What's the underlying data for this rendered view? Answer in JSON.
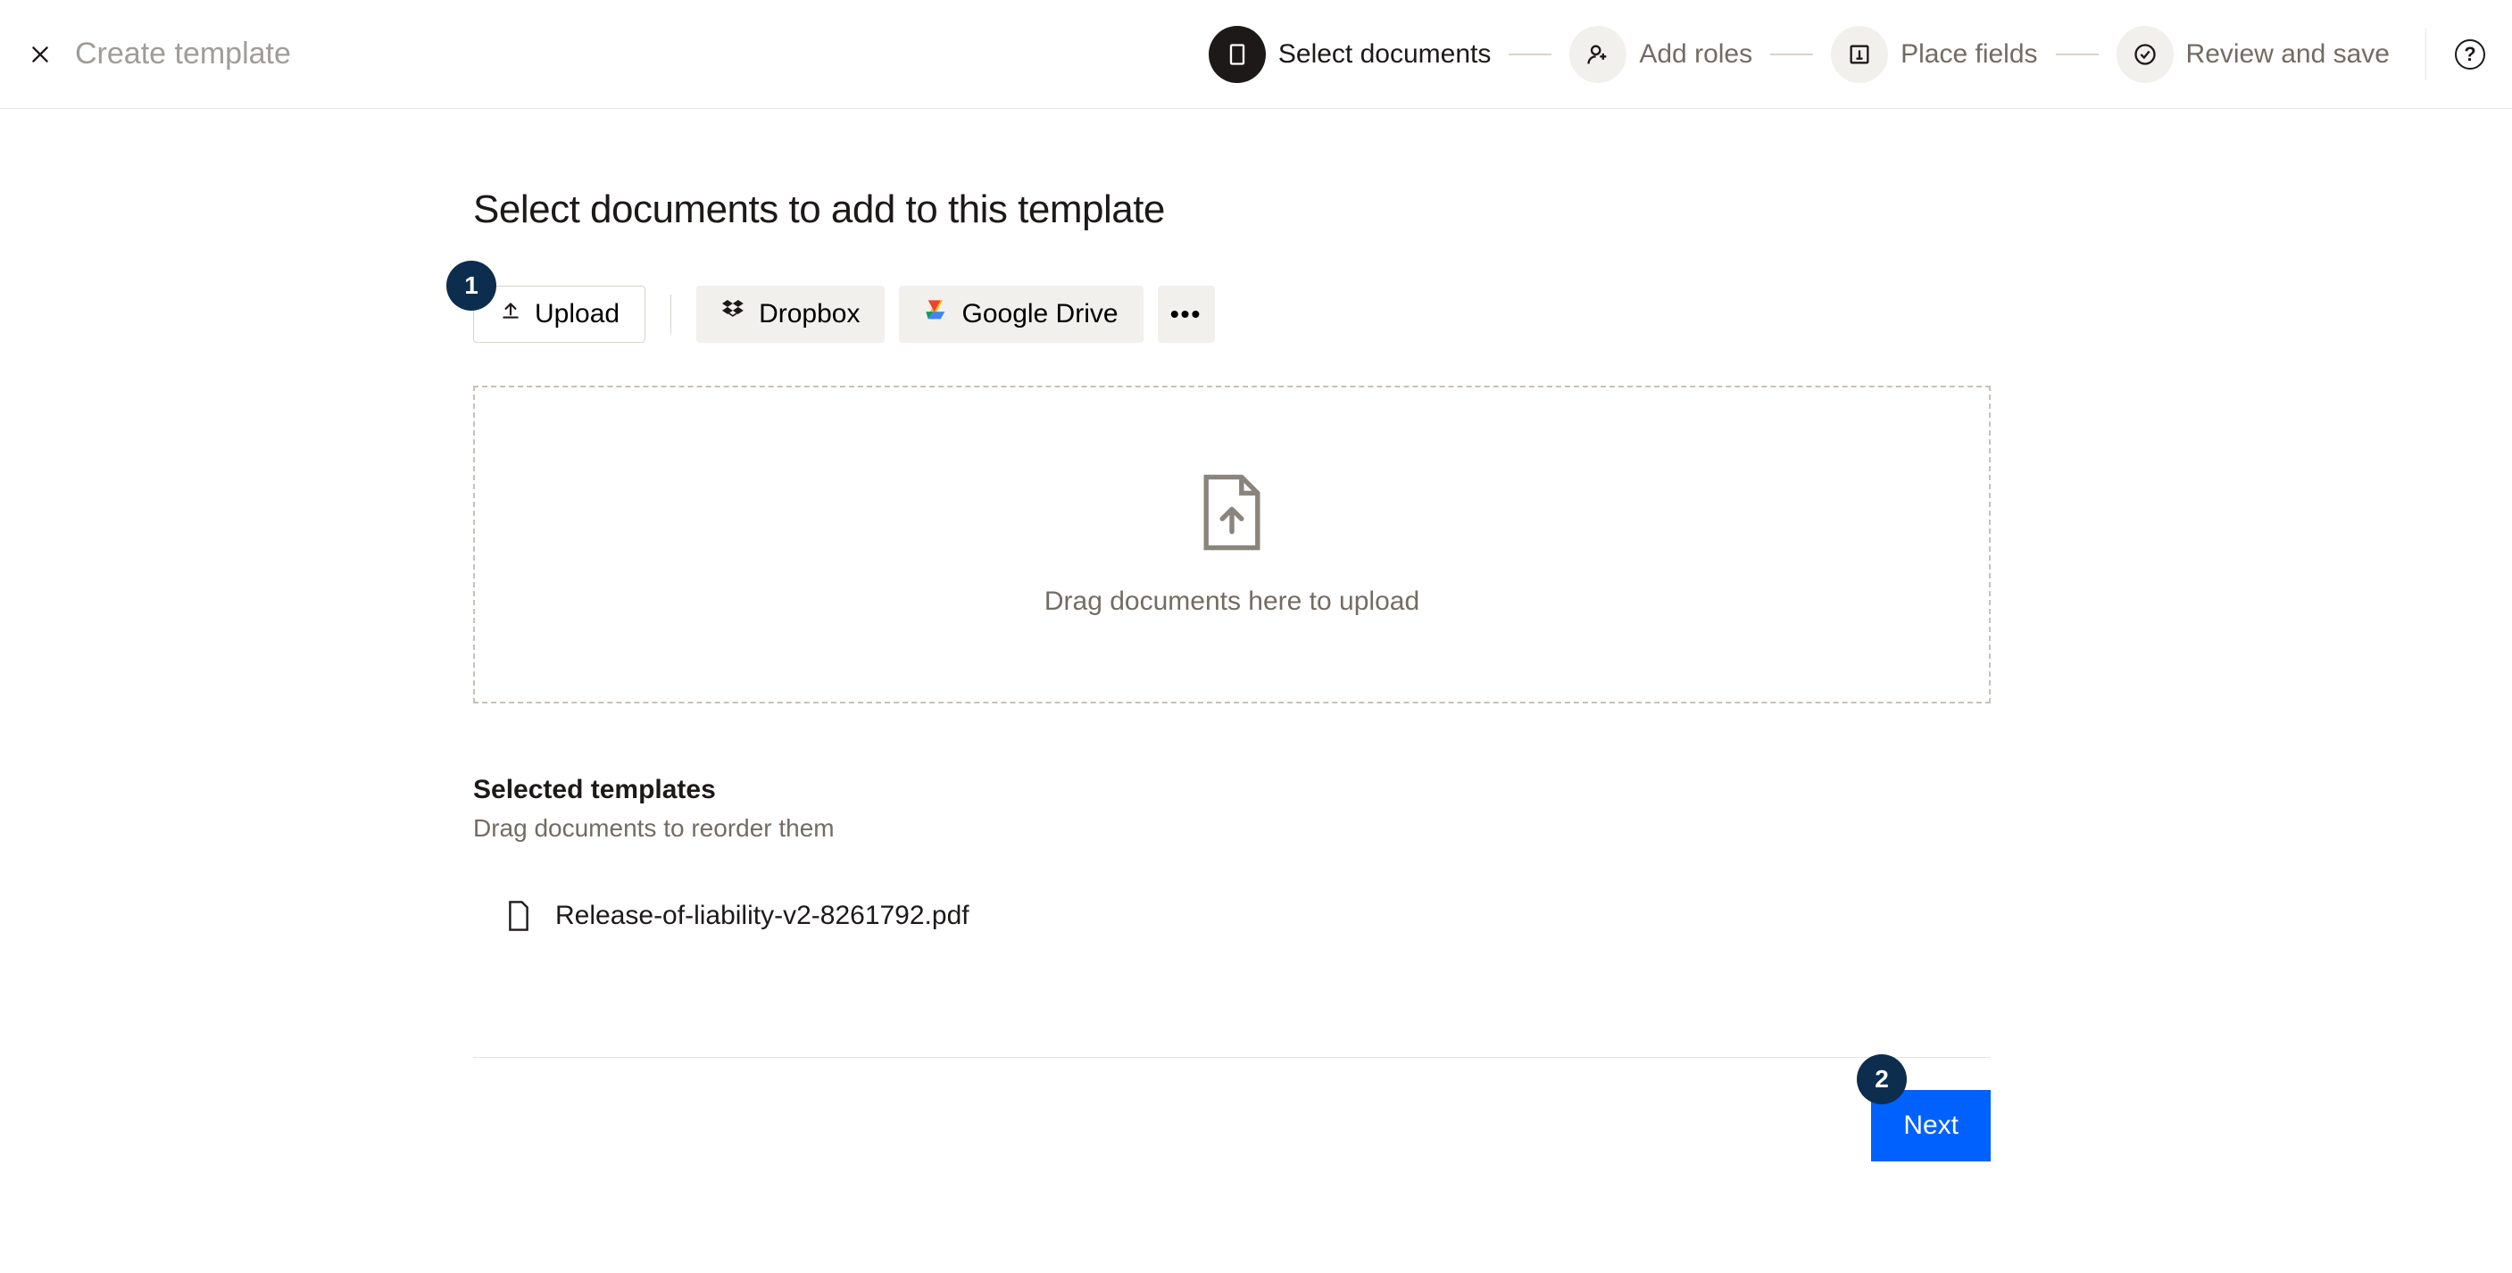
{
  "header": {
    "title": "Create template",
    "steps": [
      {
        "label": "Select documents",
        "icon": "document-icon"
      },
      {
        "label": "Add roles",
        "icon": "person-plus-icon"
      },
      {
        "label": "Place fields",
        "icon": "fields-icon"
      },
      {
        "label": "Review and save",
        "icon": "check-circle-icon"
      }
    ]
  },
  "main": {
    "heading": "Select documents to add to this template",
    "sources": {
      "upload": "Upload",
      "dropbox": "Dropbox",
      "gdrive": "Google Drive"
    },
    "dropzone_text": "Drag documents here to upload",
    "selected": {
      "title": "Selected templates",
      "subtitle": "Drag documents to reorder them",
      "files": [
        {
          "name": "Release-of-liability-v2-8261792.pdf"
        }
      ]
    }
  },
  "footer": {
    "next": "Next"
  },
  "callouts": {
    "one": "1",
    "two": "2"
  }
}
